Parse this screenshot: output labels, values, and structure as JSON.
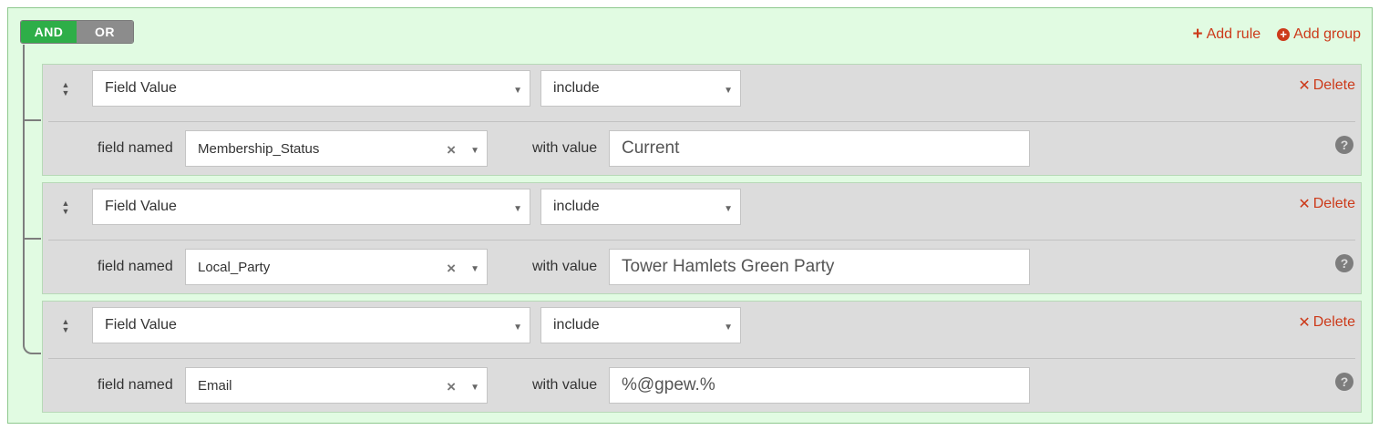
{
  "conjunction": {
    "and_label": "AND",
    "or_label": "OR",
    "active": "AND"
  },
  "group_actions": {
    "add_rule": "Add rule",
    "add_group": "Add group"
  },
  "rules": [
    {
      "type": "Field Value",
      "operator": "include",
      "field_label": "field named",
      "field": "Membership_Status",
      "value_label": "with value",
      "value": "Current",
      "delete_label": "Delete"
    },
    {
      "type": "Field Value",
      "operator": "include",
      "field_label": "field named",
      "field": "Local_Party",
      "value_label": "with value",
      "value": "Tower Hamlets Green Party",
      "delete_label": "Delete"
    },
    {
      "type": "Field Value",
      "operator": "include",
      "field_label": "field named",
      "field": "Email",
      "value_label": "with value",
      "value": "%@gpew.%",
      "delete_label": "Delete"
    }
  ],
  "icons": {
    "drag": "sort-handle-icon",
    "caret": "chevron-down-icon",
    "clear": "clear-x-icon",
    "help": "question-circle-icon",
    "delete": "times-icon",
    "add_rule": "plus-icon",
    "add_group": "plus-circle-icon"
  },
  "colors": {
    "group_bg": "#e1fbe2",
    "and_active": "#2eae48",
    "or_inactive": "#8c8c8c",
    "action_red": "#cc3a1a",
    "rule_bg": "#dcdcdc"
  }
}
